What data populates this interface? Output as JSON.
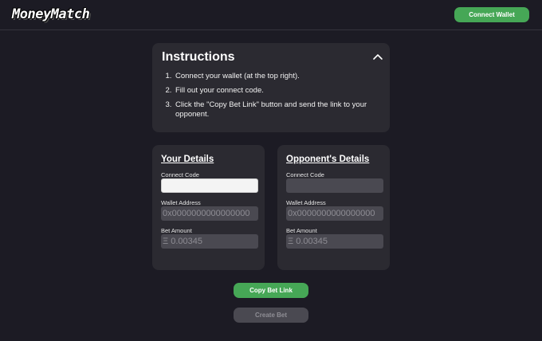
{
  "header": {
    "logo_text": "MoneyMatch",
    "connect_wallet_label": "Connect Wallet"
  },
  "instructions": {
    "title": "Instructions",
    "steps": [
      "Connect your wallet (at the top right).",
      "Fill out your connect code.",
      "Click the \"Copy Bet Link\" button and send the link to your opponent."
    ],
    "toggle_icon": "chevron-up-icon"
  },
  "your_details": {
    "title": "Your Details",
    "connect_code_label": "Connect Code",
    "connect_code_value": "",
    "wallet_address_label": "Wallet Address",
    "wallet_address_placeholder": "0x0000000000000000",
    "bet_amount_label": "Bet Amount",
    "bet_amount_placeholder": "Ξ 0.00345"
  },
  "opponent_details": {
    "title": "Opponent's Details",
    "connect_code_label": "Connect Code",
    "connect_code_value": "",
    "wallet_address_label": "Wallet Address",
    "wallet_address_placeholder": "0x0000000000000000",
    "bet_amount_label": "Bet Amount",
    "bet_amount_placeholder": "Ξ 0.00345"
  },
  "actions": {
    "copy_bet_link_label": "Copy Bet Link",
    "create_bet_label": "Create Bet"
  },
  "colors": {
    "background": "#1c1b24",
    "card": "#2b2a31",
    "accent_green": "#46a756",
    "disabled": "#4a4951"
  }
}
